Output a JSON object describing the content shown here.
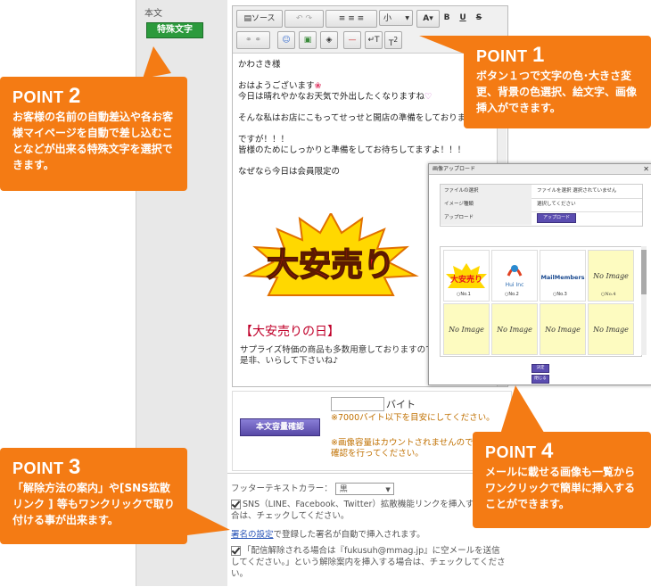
{
  "left": {
    "label": "本文",
    "special_button": "特殊文字"
  },
  "toolbar": {
    "source": "ソース",
    "size": "小"
  },
  "editor": {
    "lines": [
      "かわさき様",
      "おはようございます",
      "今日は晴れやかなお天気で外出したくなりますね",
      "そんな私はお店にこもってせっせと開店の準備をしておりますほほ",
      "ですが！！！",
      "皆様のためにしっかりと準備をしてお待ちしてますよ！！！",
      "なぜなら今日は会員限定の"
    ],
    "sale_logo": "大安売り",
    "sale_title": "【大安売りの日】",
    "sale_text": "サプライズ特価の商品も多数用意しておりますので是非、いらして下さいね♪"
  },
  "size_box": {
    "button": "本文容量確認",
    "unit": "バイト",
    "note1": "※7000バイト以下を目安にしてください。",
    "note2": "※画像容量はカウントされませんので必ず配信確認を行ってください。"
  },
  "footer": {
    "color_label": "フッターテキストカラー：",
    "color_value": "黒",
    "sns": "SNS（LINE、Facebook、Twitter）拡散機能リンクを挿入する場合は、チェックしてください。",
    "sig_link": "署名の設定",
    "sig_rest": "で登録した署名が自動で挿入されます。",
    "unsub": "「配信解除される場合は『fukusuh@mmag.jp』に空メールを送信してください。」という解除案内を挿入する場合は、チェックしてください。"
  },
  "callouts": {
    "p1": {
      "title": "POINT",
      "num": "1",
      "body": "ボタン１つで文字の色･大きさ変更、背景の色選択、絵文字、画像挿入ができます。"
    },
    "p2": {
      "title": "POINT",
      "num": "2",
      "body": "お客様の名前の自動差込や各お客様マイページを自動で差し込むことなどが出来る特殊文字を選択できます。"
    },
    "p3": {
      "title": "POINT",
      "num": "3",
      "body": "「解除方法の案内」や[SNS拡散リンク ] 等もワンクリックで取り付ける事が出来ます。"
    },
    "p4": {
      "title": "POINT",
      "num": "4",
      "body": "メールに載せる画像も一覧からワンクリックで簡単に挿入することができます。"
    }
  },
  "popup": {
    "title": "画像アップロード",
    "rows": [
      {
        "label": "ファイルの選択",
        "value": "ファイルを選択 選択されていません"
      },
      {
        "label": "イメージ種類",
        "value": "選択してください"
      },
      {
        "label": "アップロード",
        "value": "アップロード"
      }
    ],
    "images": [
      {
        "name": "大安売り",
        "radio": "No.1"
      },
      {
        "name": "Hui Inc",
        "radio": "No.2"
      },
      {
        "name": "MailMembers",
        "radio": "No.3"
      },
      {
        "name": "No Image",
        "radio": "No.4"
      },
      {
        "name": "No Image"
      },
      {
        "name": "No Image"
      },
      {
        "name": "No Image"
      },
      {
        "name": "No Image"
      }
    ],
    "btn1": "決定",
    "btn2": "閉じる"
  }
}
